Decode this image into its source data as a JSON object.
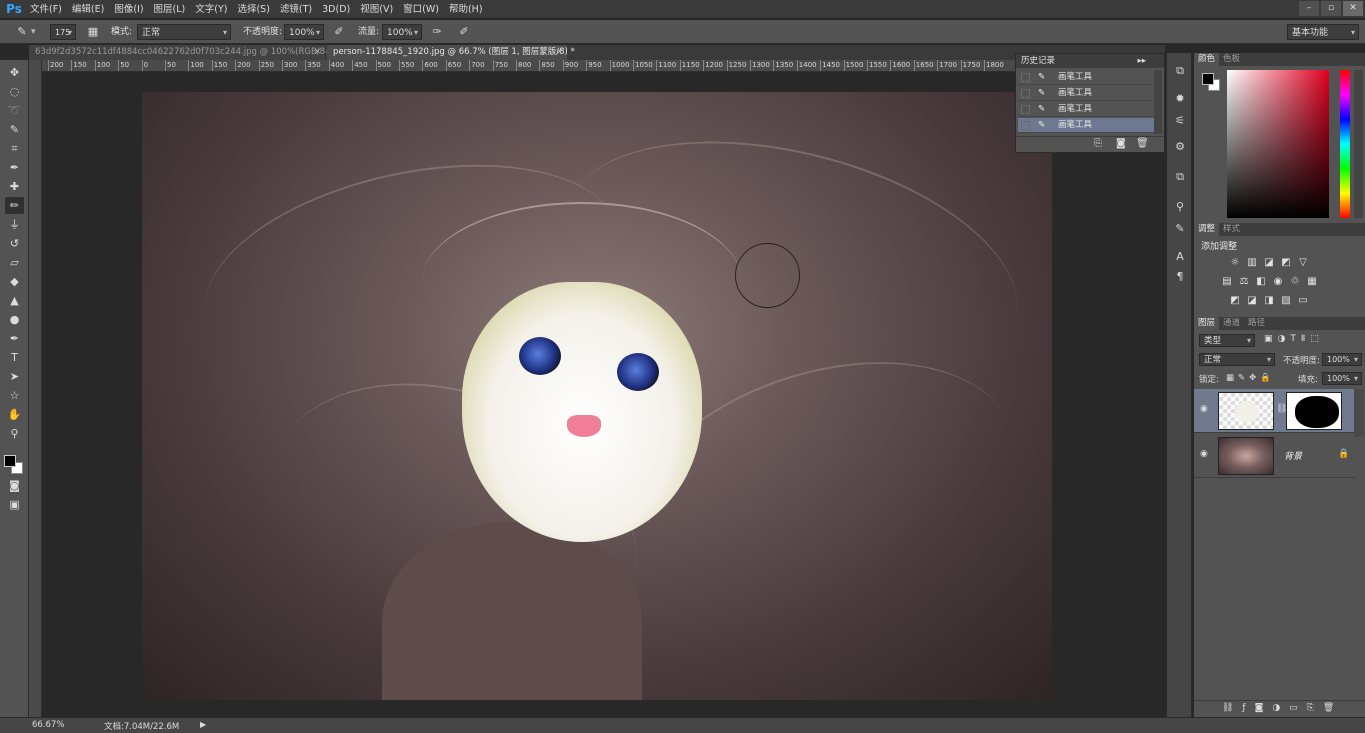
{
  "app": {
    "logo": "Ps"
  },
  "menu": [
    "文件(F)",
    "编辑(E)",
    "图像(I)",
    "图层(L)",
    "文字(Y)",
    "选择(S)",
    "滤镜(T)",
    "3D(D)",
    "视图(V)",
    "窗口(W)",
    "帮助(H)"
  ],
  "window_buttons": [
    "–",
    "▫",
    "✕"
  ],
  "options": {
    "brush_size": "175",
    "mode_label": "模式:",
    "mode_value": "正常",
    "opacity_label": "不透明度:",
    "opacity_value": "100%",
    "flow_label": "流量:",
    "flow_value": "100%",
    "workspace": "基本功能"
  },
  "tabs": [
    {
      "label": "63d9f2d3572c11df4884cc04622762d0f703c244.jpg @ 100%(RGB/8#)",
      "close": "×"
    },
    {
      "label": "person-1178845_1920.jpg @ 66.7% (图层 1, 图层蒙版/8) *",
      "close": "×"
    }
  ],
  "ruler_ticks": [
    "200",
    "150",
    "100",
    "50",
    "0",
    "50",
    "100",
    "150",
    "200",
    "250",
    "300",
    "350",
    "400",
    "450",
    "500",
    "550",
    "600",
    "650",
    "700",
    "750",
    "800",
    "850",
    "900",
    "950",
    "1000",
    "1050",
    "1100",
    "1150",
    "1200",
    "1250",
    "1300",
    "1350",
    "1400",
    "1450",
    "1500",
    "1550",
    "1600",
    "1650",
    "1700",
    "1750",
    "1800"
  ],
  "history": {
    "title": "历史记录",
    "collapse": "▸▸",
    "items": [
      "画笔工具",
      "画笔工具",
      "画笔工具",
      "画笔工具"
    ],
    "selected_index": 3
  },
  "color_panel": {
    "tabs": [
      "颜色",
      "色板"
    ],
    "fg": "#000000",
    "bg": "#ffffff"
  },
  "adjust_panel": {
    "tabs": [
      "调整",
      "样式"
    ],
    "title": "添加调整"
  },
  "layers_panel": {
    "tabs": [
      "图层",
      "通道",
      "路径"
    ],
    "filter_value": "类型",
    "blend_value": "正常",
    "opacity_label": "不透明度:",
    "opacity_value": "100%",
    "lock_label": "锁定:",
    "fill_label": "填充:",
    "fill_value": "100%",
    "layers": [
      {
        "name": "",
        "selected": true
      },
      {
        "name": "背景",
        "selected": false
      }
    ]
  },
  "status": {
    "zoom": "66.67%",
    "doc": "文档:7.04M/22.6M",
    "arrow": "▶"
  }
}
